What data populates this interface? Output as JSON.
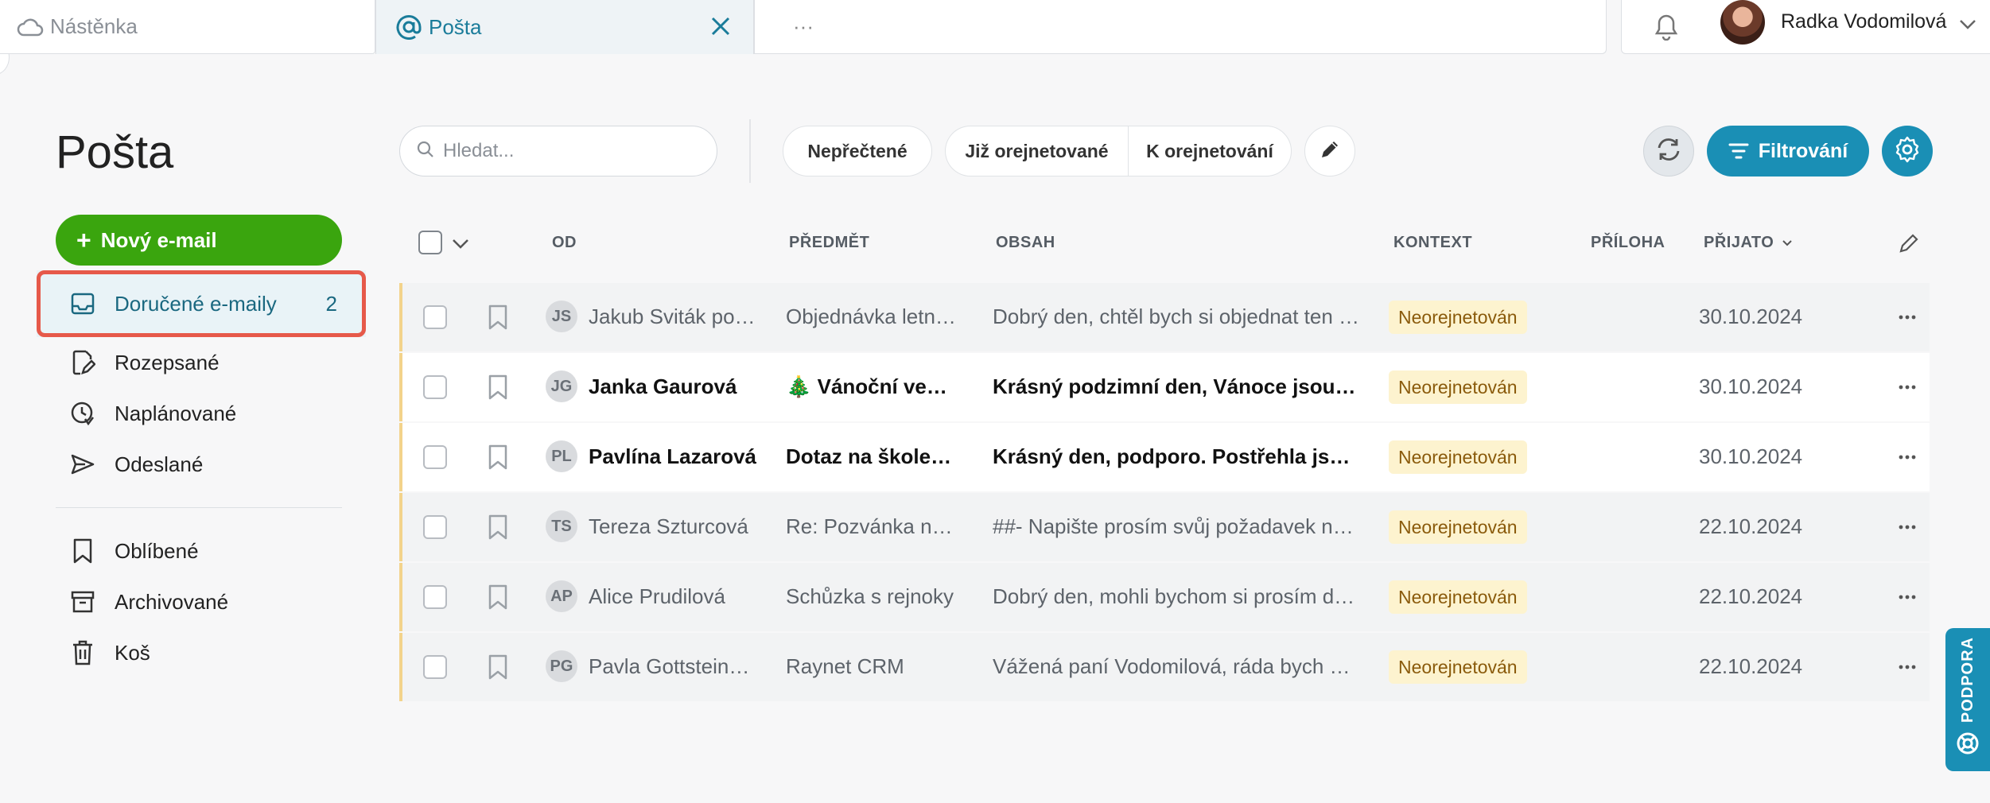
{
  "tabs": {
    "dashboard_label": "Nástěnka",
    "mail_label": "Pošta",
    "more_label": "···"
  },
  "user": {
    "name": "Radka Vodomilová"
  },
  "page": {
    "title": "Pošta"
  },
  "sidebar": {
    "new_email_label": "Nový e-mail",
    "items": [
      {
        "label": "Doručené e-maily",
        "count": "2",
        "icon": "inbox-icon"
      },
      {
        "label": "Rozepsané",
        "icon": "draft-icon"
      },
      {
        "label": "Naplánované",
        "icon": "scheduled-icon"
      },
      {
        "label": "Odeslané",
        "icon": "send-icon"
      },
      {
        "label": "Oblíbené",
        "icon": "bookmark-icon"
      },
      {
        "label": "Archivované",
        "icon": "archive-icon"
      },
      {
        "label": "Koš",
        "icon": "trash-icon"
      }
    ]
  },
  "toolbar": {
    "search_placeholder": "Hledat...",
    "unread_label": "Nepřečtené",
    "done_label": "Již orejnetované",
    "todo_label": "K orejnetování",
    "filter_label": "Filtrování"
  },
  "table": {
    "columns": {
      "from": "OD",
      "subject": "PŘEDMĚT",
      "body": "OBSAH",
      "context": "KONTEXT",
      "attachment": "PŘÍLOHA",
      "received": "PŘIJATO"
    },
    "rows": [
      {
        "initials": "JS",
        "from": "Jakub Sviták po…",
        "subject": "Objednávka letní…",
        "body": "Dobrý den, chtěl bych si objednat ten l…",
        "context": "Neorejnetován",
        "date": "30.10.2024",
        "unread": false
      },
      {
        "initials": "JG",
        "from": "Janka Gaurová",
        "subject": "🎄 Vánoční večír…",
        "body": "Krásný podzimní den, Vánoce jsou za …",
        "context": "Neorejnetován",
        "date": "30.10.2024",
        "unread": true
      },
      {
        "initials": "PL",
        "from": "Pavlína Lazarová",
        "subject": "Dotaz na školení …",
        "body": "Krásný den, podporo. Postřehla jsem, …",
        "context": "Neorejnetován",
        "date": "30.10.2024",
        "unread": true
      },
      {
        "initials": "TS",
        "from": "Tereza Szturcová",
        "subject": "Re: Pozvánka na …",
        "body": "##- Napište prosím svůj požadavek na…",
        "context": "Neorejnetován",
        "date": "22.10.2024",
        "unread": false
      },
      {
        "initials": "AP",
        "from": "Alice Prudilová",
        "subject": "Schůzka s rejnoky",
        "body": "Dobrý den, mohli bychom si prosím do…",
        "context": "Neorejnetován",
        "date": "22.10.2024",
        "unread": false
      },
      {
        "initials": "PG",
        "from": "Pavla Gottstein…",
        "subject": "Raynet CRM",
        "body": "Vážená paní Vodomilová, ráda bych V…",
        "context": "Neorejnetován",
        "date": "22.10.2024",
        "unread": false
      }
    ]
  },
  "support": {
    "label": "PODPORA"
  },
  "colors": {
    "accent": "#1a8fb5",
    "new_button": "#3aa50e",
    "highlight": "#e6594a",
    "badge_bg": "#fdf3cf"
  }
}
